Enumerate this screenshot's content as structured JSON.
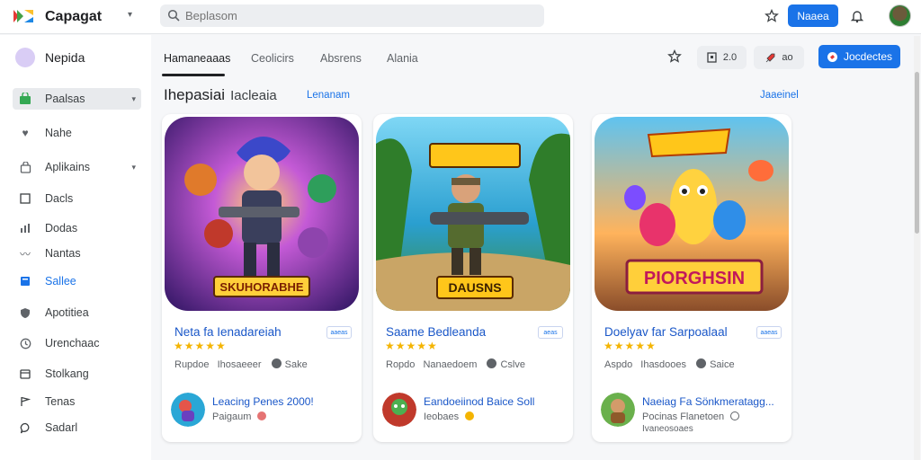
{
  "header": {
    "app_title": "Capagat",
    "search_placeholder": "Beplasom",
    "button_label": "Naaea"
  },
  "sidebar": {
    "profile_name": "Nepida",
    "items": [
      {
        "label": "Paalsas",
        "icon": "store-icon"
      },
      {
        "label": "Nahe",
        "icon": "heart-icon"
      },
      {
        "label": "Aplikains",
        "icon": "bag-icon"
      },
      {
        "label": "Dacls",
        "icon": "square-icon"
      },
      {
        "label": "Dodas",
        "icon": "bars-icon"
      },
      {
        "label": "Nantas",
        "icon": "wave-icon"
      },
      {
        "label": "Sallee",
        "icon": "grid-icon"
      },
      {
        "label": "Apotitiea",
        "icon": "shield-icon"
      },
      {
        "label": "Urenchaac",
        "icon": "clock-icon"
      },
      {
        "label": "Stolkang",
        "icon": "box-icon"
      },
      {
        "label": "Tenas",
        "icon": "flag-icon"
      },
      {
        "label": "Sadarl",
        "icon": "chat-icon"
      }
    ]
  },
  "tabs": [
    "Hamaneaaas",
    "Ceolicirs",
    "Absrens",
    "Alania"
  ],
  "toolbar": {
    "btn1_label": "2.0",
    "btn2_label": "ao",
    "primary_label": "Jocdectes"
  },
  "section": {
    "title": "Ihepasiai",
    "subtitle": "Iacleaia",
    "link": "Lenanam",
    "more": "Jaaeinel"
  },
  "cards": [
    {
      "banner": "SKUHORABHE",
      "title": "Neta fa Ienadareiah",
      "tag": "aaeas",
      "stars": "★★★★★",
      "meta_a": "Rupdoe",
      "meta_b": "Ihosaeeer",
      "meta_c": "Sake",
      "sub_title": "Leacing Penes 2000!",
      "sub_meta": "Paigaum"
    },
    {
      "banner": "DAUSNS",
      "title": "Saame Bedleanda",
      "tag": "aeas",
      "stars": "★★★★★",
      "meta_a": "Ropdo",
      "meta_b": "Nanaedoem",
      "meta_c": "Cslve",
      "sub_title": "Eandoeiinod Baice Soll",
      "sub_meta": "Ieobaes"
    },
    {
      "banner": "PIORGHSIN",
      "title": "Doelyav far Sarpoalaal",
      "tag": "aaeas",
      "stars": "★★★★★",
      "meta_a": "Aspdo",
      "meta_b": "Ihasdooes",
      "meta_c": "Saice",
      "sub_title": "Naeiag Fa Sönkmeratagg...",
      "sub_meta": "Pocinas Flanetoen",
      "sub_meta2": "Ivaneosoaes"
    }
  ],
  "colors": {
    "accent": "#1a73e8",
    "star": "#f4b400",
    "link": "#1a57c8"
  }
}
